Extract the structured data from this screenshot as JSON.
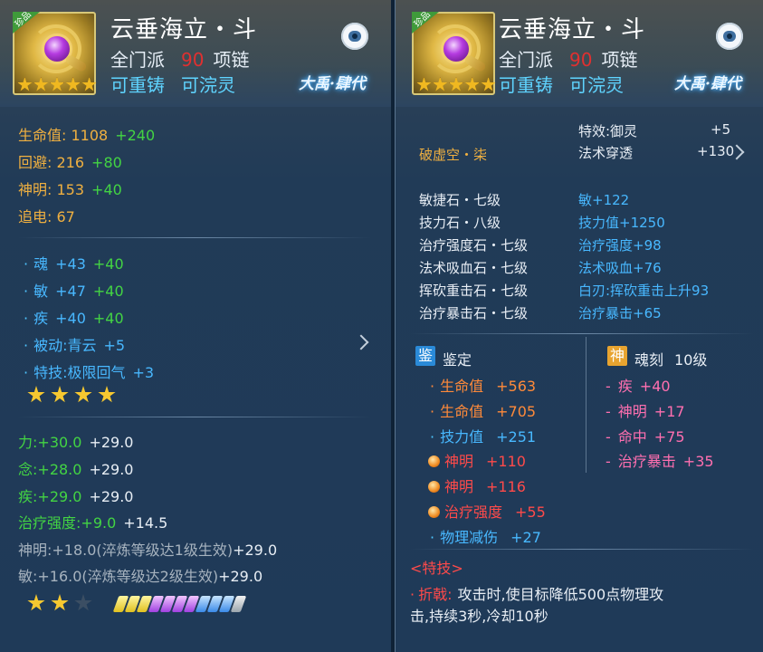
{
  "left": {
    "badge": "珍品",
    "title": "云垂海立・斗",
    "sect": "全门派",
    "level": "90",
    "slot": "项链",
    "tags": [
      "可重铸",
      "可浣灵"
    ],
    "brand": "大禹·肆代",
    "stats": [
      {
        "label": "生命值:",
        "base": "1108",
        "bonus": "+240"
      },
      {
        "label": "回避:",
        "base": "216",
        "bonus": "+80"
      },
      {
        "label": "神明:",
        "base": "153",
        "bonus": "+40"
      },
      {
        "label": "追电:",
        "base": "67",
        "bonus": ""
      }
    ],
    "attrs": [
      {
        "label": "魂",
        "a": "+43",
        "b": "+40"
      },
      {
        "label": "敏",
        "a": "+47",
        "b": "+40"
      },
      {
        "label": "疾",
        "a": "+40",
        "b": "+40"
      }
    ],
    "passive": {
      "label": "被动:",
      "name": "青云",
      "value": "+5"
    },
    "skill": {
      "label": "特技:",
      "name": "极限回气",
      "value": "+3"
    },
    "stars_filled": 4,
    "refine": [
      {
        "label": "力:",
        "a": "+30.0",
        "b": "+29.0"
      },
      {
        "label": "念:",
        "a": "+28.0",
        "b": "+29.0"
      },
      {
        "label": "疾:",
        "a": "+29.0",
        "b": "+29.0"
      },
      {
        "label": "治疗强度:",
        "a": "+9.0",
        "b": "+14.5"
      }
    ],
    "locked": [
      {
        "text": "神明:+18.0(淬炼等级达1级生效)",
        "b": "+29.0"
      },
      {
        "text": "敏:+16.0(淬炼等级达2级生效)",
        "b": "+29.0"
      }
    ],
    "bottom_stars_filled": 2,
    "bottom_stars_total": 3
  },
  "right": {
    "badge": "珍品",
    "title": "云垂海立・斗",
    "sect": "全门派",
    "level": "90",
    "slot": "项链",
    "tags": [
      "可重铸",
      "可浣灵"
    ],
    "brand": "大禹·肆代",
    "special_effect": {
      "label": "特效:御灵",
      "value": "+5"
    },
    "penetration": {
      "label": "法术穿透",
      "value": "+130"
    },
    "rune": "破虚空・柒",
    "stones": [
      {
        "name": "敏捷石・七级",
        "effect": "敏+122"
      },
      {
        "name": "技力石・八级",
        "effect": "技力值+1250"
      },
      {
        "name": "治疗强度石・七级",
        "effect": "治疗强度+98"
      },
      {
        "name": "法术吸血石・七级",
        "effect": "法术吸血+76"
      },
      {
        "name": "挥砍重击石・七级",
        "effect": "白刃:挥砍重击上升93"
      },
      {
        "name": "治疗暴击石・七级",
        "effect": "治疗暴击+65"
      }
    ],
    "appraise": {
      "tag": "鉴",
      "title": "鉴定",
      "items": [
        {
          "name": "生命值",
          "value": "+563",
          "type": "normal"
        },
        {
          "name": "生命值",
          "value": "+705",
          "type": "normal"
        },
        {
          "name": "技力值",
          "value": "+251",
          "type": "normal"
        },
        {
          "name": "神明",
          "value": "+110",
          "type": "special"
        },
        {
          "name": "神明",
          "value": "+116",
          "type": "special"
        },
        {
          "name": "治疗强度",
          "value": "+55",
          "type": "special"
        },
        {
          "name": "物理减伤",
          "value": "+27",
          "type": "normal"
        }
      ]
    },
    "soul": {
      "tag": "神",
      "title": "魂刻",
      "level": "10级",
      "items": [
        {
          "name": "疾",
          "value": "+40"
        },
        {
          "name": "神明",
          "value": "+17"
        },
        {
          "name": "命中",
          "value": "+75"
        },
        {
          "name": "治疗暴击",
          "value": "+35"
        }
      ]
    },
    "skill_header": "<特技>",
    "skill_name": "折戟:",
    "skill_line1": "攻击时,使目标降低500点物理攻",
    "skill_line2": "击,持续3秒,冷却10秒"
  }
}
